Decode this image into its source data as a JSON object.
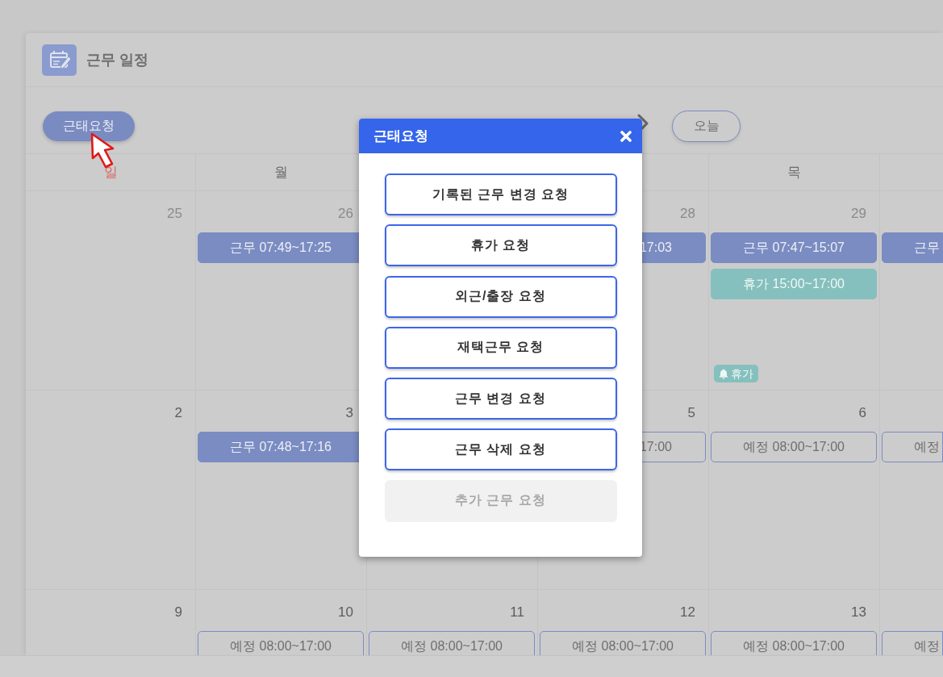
{
  "header": {
    "title": "근무 일정"
  },
  "toolbar": {
    "request_button": "근태요청",
    "today_button": "오늘"
  },
  "calendar": {
    "weekdays": [
      {
        "label": "일",
        "holiday": true
      },
      {
        "label": "월",
        "holiday": false
      },
      {
        "label": "목",
        "holiday": false
      }
    ],
    "weeks": [
      {
        "days": [
          {
            "date": "25",
            "other_month": true
          },
          {
            "date": "26",
            "other_month": true,
            "events": [
              {
                "kind": "work",
                "text": "근무 07:49~17:25",
                "cut_start": false,
                "cut_end": false
              }
            ]
          },
          {
            "date": "28",
            "other_month": true,
            "events": [
              {
                "kind": "work",
                "text": "17:03",
                "cut_start": true,
                "cut_end": false
              }
            ]
          },
          {
            "date": "29",
            "other_month": true,
            "events": [
              {
                "kind": "work",
                "text": "근무 07:47~15:07",
                "cut_start": false,
                "cut_end": false
              },
              {
                "kind": "leave",
                "text": "휴가 15:00~17:00",
                "cut_start": false,
                "cut_end": false
              }
            ],
            "badge": "휴가"
          },
          {
            "events": [
              {
                "kind": "work",
                "text": "근무",
                "cut_start": false,
                "cut_end": true
              }
            ]
          }
        ]
      },
      {
        "days": [
          {
            "date": "2",
            "other_month": false
          },
          {
            "date": "3",
            "other_month": false,
            "events": [
              {
                "kind": "work",
                "text": "근무 07:48~17:16",
                "cut_start": false,
                "cut_end": false
              }
            ]
          },
          {
            "date": "5",
            "other_month": false,
            "events": [
              {
                "kind": "planned",
                "text": "17:00",
                "cut_start": true,
                "cut_end": false
              }
            ]
          },
          {
            "date": "6",
            "other_month": false,
            "events": [
              {
                "kind": "planned",
                "text": "예정 08:00~17:00",
                "cut_start": false,
                "cut_end": false
              }
            ]
          },
          {
            "events": [
              {
                "kind": "planned",
                "text": "예정",
                "cut_start": false,
                "cut_end": true
              }
            ]
          }
        ]
      },
      {
        "days": [
          {
            "date": "9",
            "other_month": false
          },
          {
            "date": "10",
            "other_month": false,
            "events": [
              {
                "kind": "planned",
                "text": "예정 08:00~17:00",
                "cut_start": false,
                "cut_end": false
              }
            ]
          },
          {
            "date": "11",
            "other_month": false,
            "events": [
              {
                "kind": "planned",
                "text": "예정 08:00~17:00",
                "cut_start": false,
                "cut_end": false
              }
            ]
          },
          {
            "date": "12",
            "other_month": false,
            "events": [
              {
                "kind": "planned",
                "text": "예정 08:00~17:00",
                "cut_start": false,
                "cut_end": false
              }
            ]
          },
          {
            "date": "13",
            "other_month": false,
            "events": [
              {
                "kind": "planned",
                "text": "예정 08:00~17:00",
                "cut_start": false,
                "cut_end": false
              }
            ]
          },
          {
            "events": [
              {
                "kind": "planned",
                "text": "예정",
                "cut_start": false,
                "cut_end": true
              }
            ]
          }
        ]
      }
    ]
  },
  "modal": {
    "title": "근태요청",
    "buttons": [
      {
        "label": "기록된 근무 변경 요청",
        "disabled": false
      },
      {
        "label": "휴가 요청",
        "disabled": false
      },
      {
        "label": "외근/출장 요청",
        "disabled": false
      },
      {
        "label": "재택근무 요청",
        "disabled": false
      },
      {
        "label": "근무 변경 요청",
        "disabled": false
      },
      {
        "label": "근무 삭제 요청",
        "disabled": false
      },
      {
        "label": "추가 근무 요청",
        "disabled": true
      }
    ]
  }
}
